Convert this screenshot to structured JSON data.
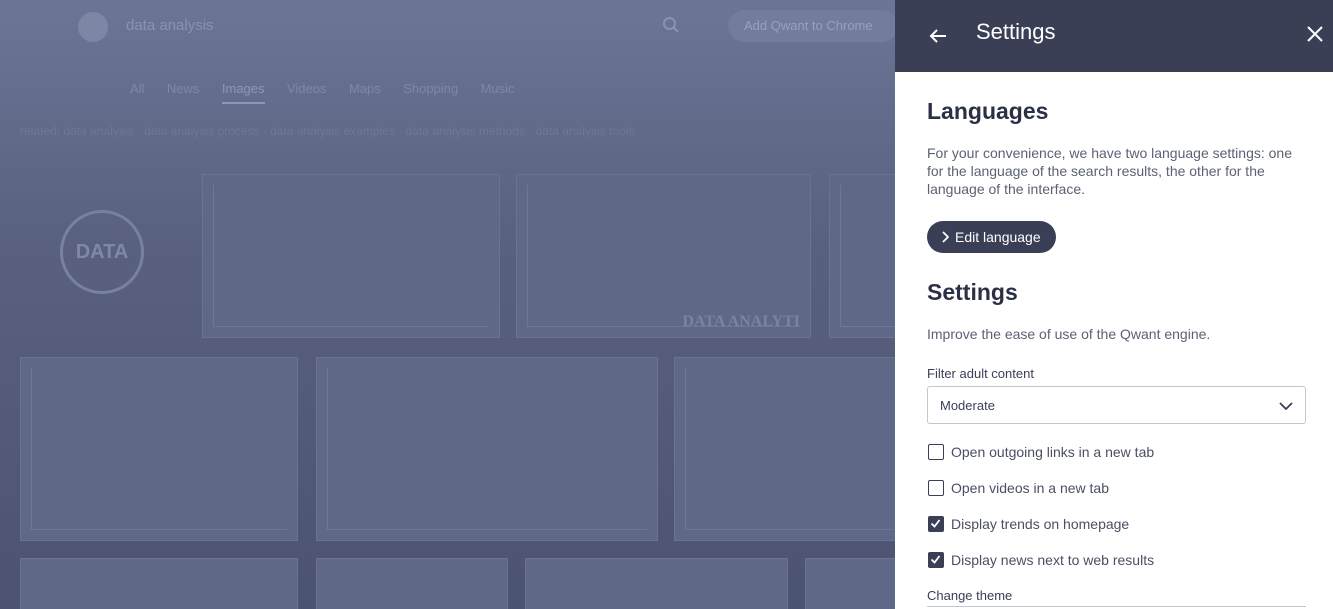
{
  "background": {
    "search_query": "data analysis",
    "extension_button_label": "Add Qwant to Chrome",
    "tabs": [
      {
        "label": "All"
      },
      {
        "label": "News"
      },
      {
        "label": "Images"
      },
      {
        "label": "Videos"
      },
      {
        "label": "Maps"
      },
      {
        "label": "Shopping"
      },
      {
        "label": "Music"
      }
    ],
    "active_tab": 2,
    "related_searches": "related: data analysis · data analysis process · data analysis examples · data analysis methods · data analysis tools",
    "tile_logo_text": "DATA",
    "tile_caption": "DATA ANALYTI"
  },
  "panel": {
    "header_title": "Settings",
    "languages": {
      "heading": "Languages",
      "description": "For your convenience, we have two language settings: one for the language of the search results, the other for the language of the interface.",
      "edit_button": "Edit language"
    },
    "settings": {
      "heading": "Settings",
      "description": "Improve the ease of use of the Qwant engine.",
      "filter_label": "Filter adult content",
      "filter_value": "Moderate",
      "checkboxes": [
        {
          "label": "Open outgoing links in a new tab",
          "checked": false
        },
        {
          "label": "Open videos in a new tab",
          "checked": false
        },
        {
          "label": "Display trends on homepage",
          "checked": true
        },
        {
          "label": "Display news next to web results",
          "checked": true
        }
      ],
      "theme_label": "Change theme"
    }
  },
  "colors": {
    "header_bg": "#3a3f56",
    "accent": "#3a3f56",
    "overlay_bg": "#5d6586"
  },
  "icons": {
    "back": "arrow-left-icon",
    "close": "close-icon",
    "chevron": "chevron-down-icon",
    "check": "check-icon"
  }
}
